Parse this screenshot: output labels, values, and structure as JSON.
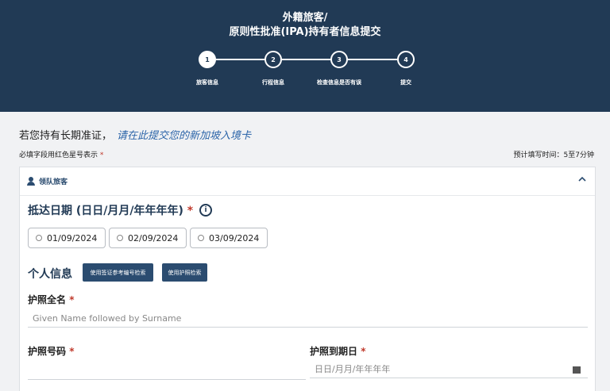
{
  "header": {
    "title_line1": "外籍旅客/",
    "title_line2": "原则性批准(IPA)持有者信息提交",
    "steps": [
      {
        "number": "1",
        "label": "旅客信息",
        "active": true
      },
      {
        "number": "2",
        "label": "行程信息",
        "active": false
      },
      {
        "number": "3",
        "label": "检查信息是否有误",
        "active": false
      },
      {
        "number": "4",
        "label": "提交",
        "active": false
      }
    ]
  },
  "intro": {
    "long_pass_prefix": "若您持有长期准证，",
    "long_pass_link": "请在此提交您的新加坡入境卡",
    "required_note": "必填字段用红色星号表示",
    "required_star": "*",
    "time_estimate": "预计填写时间：5至7分钟"
  },
  "card": {
    "section_title": "领队旅客",
    "arrival_label": "抵达日期 (日日/月月/年年年年)",
    "required_star": "*",
    "info_glyph": "i",
    "dates": [
      "01/09/2024",
      "02/09/2024",
      "03/09/2024"
    ],
    "personal_info_label": "个人信息",
    "btn_visa_search": "使用签证参考编号检索",
    "btn_passport_search": "使用护照检索",
    "passport_name_label": "护照全名",
    "passport_name_placeholder": "Given Name followed by Surname",
    "passport_number_label": "护照号码",
    "passport_number_value": "",
    "passport_expiry_label": "护照到期日",
    "passport_expiry_placeholder": "日日/月月/年年年年"
  },
  "colors": {
    "header_bg": "#213a55",
    "accent": "#2b4c70",
    "link": "#2b64a8",
    "required": "#c0392b"
  }
}
